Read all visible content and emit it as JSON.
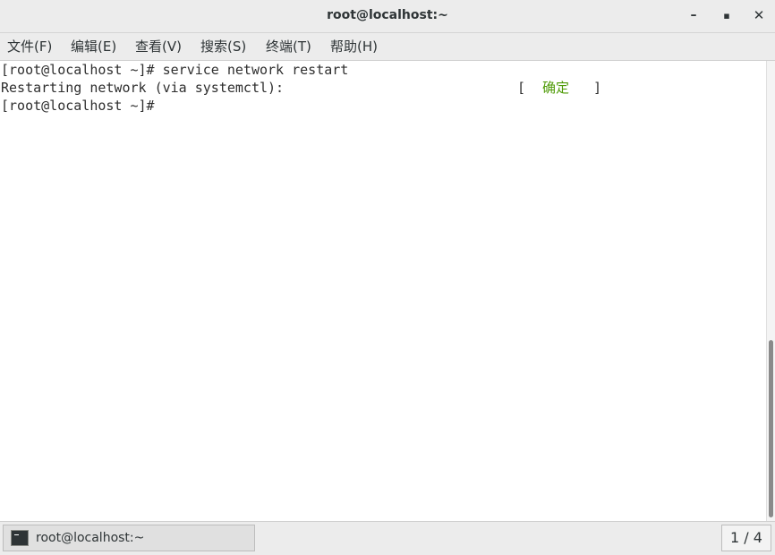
{
  "window": {
    "title": "root@localhost:~",
    "controls": {
      "minimize": "–",
      "maximize": "▪",
      "close": "✕"
    }
  },
  "menu": {
    "items": [
      "文件(F)",
      "编辑(E)",
      "查看(V)",
      "搜索(S)",
      "终端(T)",
      "帮助(H)"
    ]
  },
  "terminal": {
    "lines": [
      "[root@localhost ~]# service network restart",
      "Restarting network (via systemctl):",
      "[root@localhost ~]#"
    ],
    "status": {
      "open": "[",
      "text": "确定",
      "close": "]",
      "color": "#4e9a06"
    }
  },
  "taskbar": {
    "task_label": "root@localhost:~",
    "workspace": "1 / 4"
  }
}
